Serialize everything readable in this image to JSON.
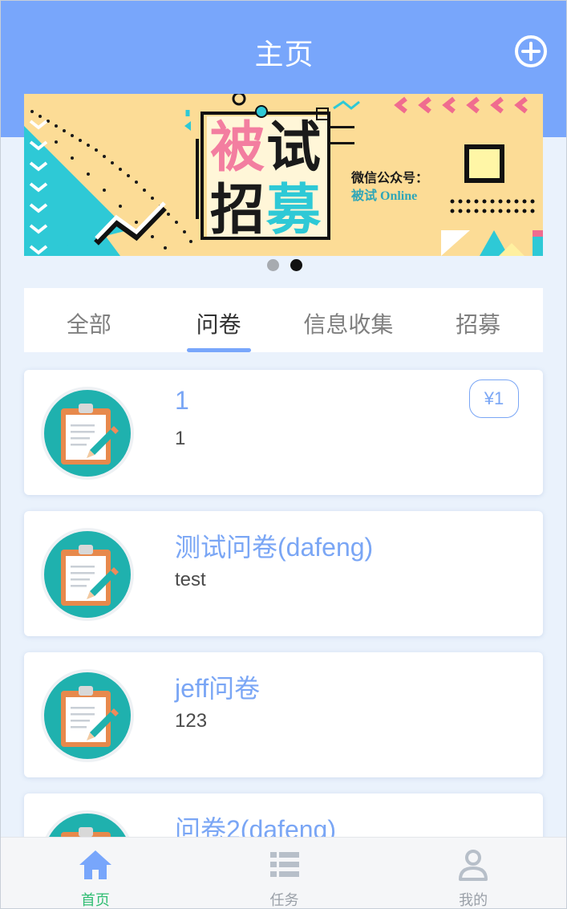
{
  "header": {
    "title": "主页"
  },
  "banner": {
    "chars": [
      "被",
      "试",
      "招",
      "募"
    ],
    "wechat_label": "微信公众号：",
    "account_name": "被试 Online"
  },
  "tabs": [
    {
      "label": "全部",
      "active": false
    },
    {
      "label": "问卷",
      "active": true
    },
    {
      "label": "信息收集",
      "active": false
    },
    {
      "label": "招募",
      "active": false
    }
  ],
  "cards": [
    {
      "title": "1",
      "desc": "1",
      "price": "¥1"
    },
    {
      "title": "测试问卷(dafeng)",
      "desc": "test"
    },
    {
      "title": "jeff问卷",
      "desc": "123"
    },
    {
      "title": "问卷2(dafeng)",
      "desc": ""
    }
  ],
  "bottom_nav": [
    {
      "label": "首页",
      "icon": "home-icon",
      "active": true
    },
    {
      "label": "任务",
      "icon": "list-icon",
      "active": false
    },
    {
      "label": "我的",
      "icon": "user-icon",
      "active": false
    }
  ],
  "colors": {
    "primary": "#78a6fb",
    "active_nav": "#2fbd72",
    "page_bg": "#eaf2fc",
    "banner_bg": "#fcdc96"
  }
}
